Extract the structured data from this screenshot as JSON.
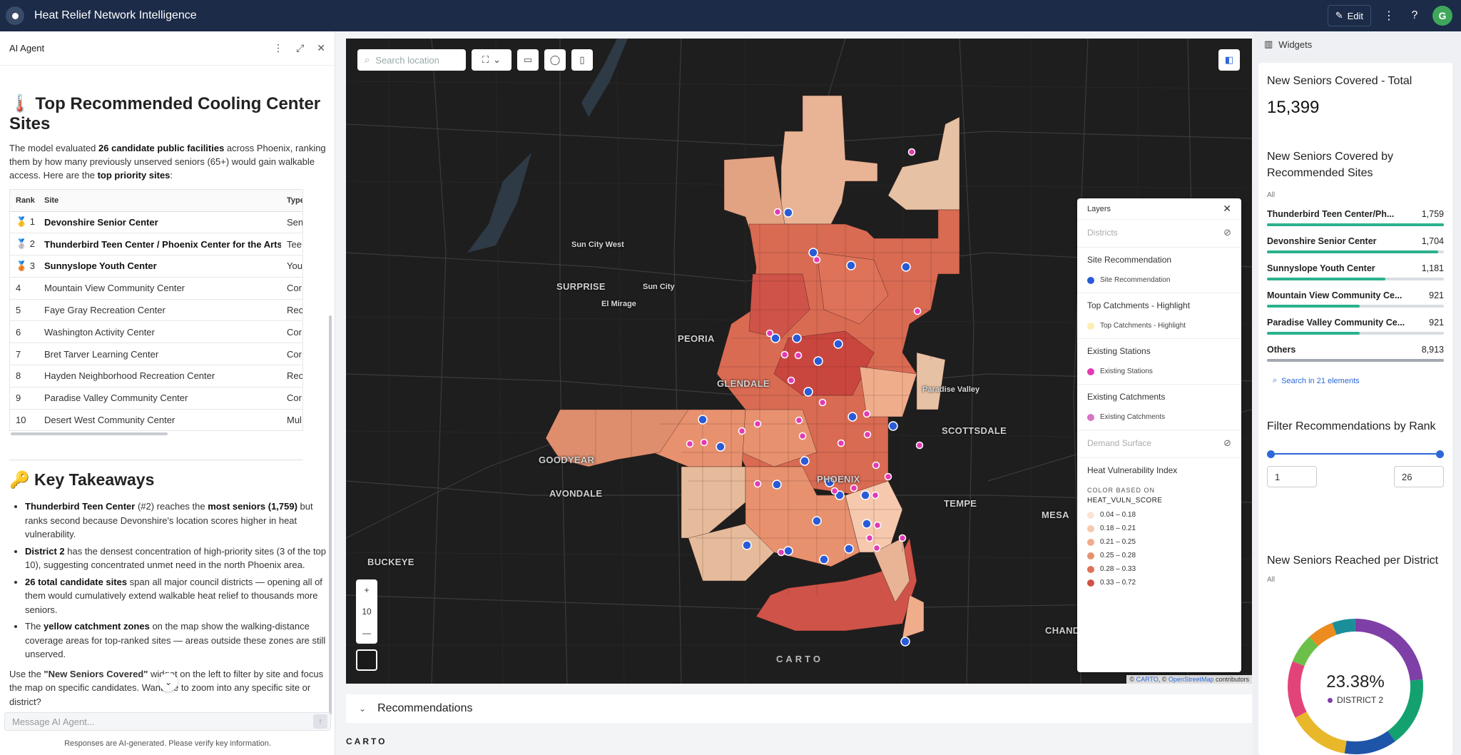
{
  "app": {
    "title": "Heat Relief Network Intelligence",
    "edit_label": "Edit",
    "avatar_initial": "G"
  },
  "agent": {
    "panel_title": "AI Agent",
    "heading": "🌡️ Top Recommended Cooling Center Sites",
    "intro_1": "The model evaluated ",
    "intro_b1": "26 candidate public facilities",
    "intro_2": " across Phoenix, ranking them by how many previously unserved seniors (65+) would gain walkable access. Here are the ",
    "intro_b2": "top priority sites",
    "intro_3": ":",
    "table": {
      "headers": [
        "Rank",
        "Site",
        "Type"
      ],
      "rows": [
        {
          "rank": "🥇 1",
          "site": "Devonshire Senior Center",
          "type": "Sen",
          "bold": true
        },
        {
          "rank": "🥈 2",
          "site": "Thunderbird Teen Center / Phoenix Center for the Arts",
          "type": "Tee",
          "bold": true
        },
        {
          "rank": "🥉 3",
          "site": "Sunnyslope Youth Center",
          "type": "You",
          "bold": true
        },
        {
          "rank": "4",
          "site": "Mountain View Community Center",
          "type": "Cor",
          "bold": false
        },
        {
          "rank": "5",
          "site": "Faye Gray Recreation Center",
          "type": "Rec",
          "bold": false
        },
        {
          "rank": "6",
          "site": "Washington Activity Center",
          "type": "Cor",
          "bold": false
        },
        {
          "rank": "7",
          "site": "Bret Tarver Learning Center",
          "type": "Cor",
          "bold": false
        },
        {
          "rank": "8",
          "site": "Hayden Neighborhood Recreation Center",
          "type": "Rec",
          "bold": false
        },
        {
          "rank": "9",
          "site": "Paradise Valley Community Center",
          "type": "Cor",
          "bold": false
        },
        {
          "rank": "10",
          "site": "Desert West Community Center",
          "type": "Mul",
          "bold": false
        }
      ]
    },
    "takeaways_heading": "🔑 Key Takeaways",
    "takeaways": [
      {
        "b": "Thunderbird Teen Center",
        "t1": " (#2) reaches the ",
        "b2": "most seniors (1,759)",
        "t2": " but ranks second because Devonshire's location scores higher in heat vulnerability."
      },
      {
        "b": "District 2",
        "t1": " has the densest concentration of high-priority sites (3 of the top 10), suggesting concentrated unmet need in the north Phoenix area.",
        "b2": "",
        "t2": ""
      },
      {
        "b": "26 total candidate sites",
        "t1": " span all major council districts — opening all of them would cumulatively extend walkable heat relief to thousands more seniors.",
        "b2": "",
        "t2": ""
      },
      {
        "b": "",
        "t1": "The ",
        "b2": "yellow catchment zones",
        "t2": " on the map show the walking-distance coverage areas for top-ranked sites — areas outside these zones are still unserved."
      }
    ],
    "outro_1": "Use the ",
    "outro_b": "\"New Seniors Covered\"",
    "outro_2": " widget on the left to filter by site and focus the map on specific candidates. Want me to zoom into any specific site or district?",
    "input_placeholder": "Message AI Agent...",
    "disclaimer": "Responses are AI-generated. Please verify key information."
  },
  "map": {
    "search_placeholder": "Search location",
    "zoom_level": "10",
    "places_big": [
      "SURPRISE",
      "PEORIA",
      "GLENDALE",
      "GOODYEAR",
      "AVONDALE",
      "BUCKEYE",
      "PHOENIX",
      "SCOTTSDALE",
      "TEMPE",
      "MESA",
      "CHANDLER"
    ],
    "places_small": [
      "Sun City West",
      "Sun City",
      "El Mirage",
      "Paradise Valley"
    ],
    "carto_mark": "CARTO",
    "attribution_1": "© ",
    "attribution_carto": "CARTO",
    "attribution_2": ", © ",
    "attribution_osm": "OpenStreetMap",
    "attribution_3": " contributors"
  },
  "layers": {
    "title": "Layers",
    "districts": "Districts",
    "site_rec_title": "Site Recommendation",
    "site_rec_item": "Site Recommendation",
    "site_rec_color": "#2a5bd7",
    "top_catch_title": "Top Catchments - Highlight",
    "top_catch_item": "Top Catchments - Highlight",
    "top_catch_color": "#fbeeb0",
    "existing_title": "Existing Stations",
    "existing_item": "Existing Stations",
    "existing_color": "#e23bb3",
    "ex_catch_title": "Existing Catchments",
    "ex_catch_item": "Existing Catchments",
    "ex_catch_color": "#d873c4",
    "demand": "Demand Surface",
    "hvi_title": "Heat Vulnerability Index",
    "color_based_on": "COLOR BASED ON",
    "field": "HEAT_VULN_SCORE",
    "bins": [
      {
        "label": "0.04 – 0.18",
        "color": "#fbe4d4"
      },
      {
        "label": "0.18 – 0.21",
        "color": "#f6c9ae"
      },
      {
        "label": "0.21 – 0.25",
        "color": "#f0ad8c"
      },
      {
        "label": "0.25 – 0.28",
        "color": "#e8916f"
      },
      {
        "label": "0.28 – 0.33",
        "color": "#de735a"
      },
      {
        "label": "0.33 – 0.72",
        "color": "#cf5348"
      }
    ]
  },
  "widgets": {
    "panel_title": "Widgets",
    "total": {
      "title": "New Seniors Covered - Total",
      "value": "15,399"
    },
    "by_site": {
      "title": "New Seniors Covered by Recommended Sites",
      "all": "All",
      "rows": [
        {
          "name": "Thunderbird Teen Center/Ph...",
          "value": "1,759",
          "frac": 1.0
        },
        {
          "name": "Devonshire Senior Center",
          "value": "1,704",
          "frac": 0.969
        },
        {
          "name": "Sunnyslope Youth Center",
          "value": "1,181",
          "frac": 0.671
        },
        {
          "name": "Mountain View Community Ce...",
          "value": "921",
          "frac": 0.524
        },
        {
          "name": "Paradise Valley Community Ce...",
          "value": "921",
          "frac": 0.524
        },
        {
          "name": "Others",
          "value": "8,913",
          "frac": 1.0
        }
      ],
      "search_label": "Search in 21 elements"
    },
    "filter": {
      "title": "Filter Recommendations by Rank",
      "min": "1",
      "max": "26"
    },
    "district": {
      "title": "New Seniors Reached per District",
      "all": "All",
      "pct": "23.38%",
      "label": "DISTRICT 2"
    }
  },
  "bottom": {
    "recommendations": "Recommendations",
    "carto": "CARTO"
  }
}
